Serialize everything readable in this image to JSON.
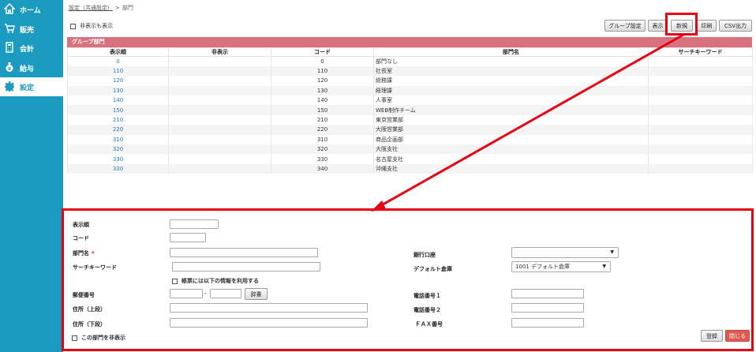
{
  "sidebar": {
    "items": [
      {
        "label": "ホーム",
        "icon": "home-icon"
      },
      {
        "label": "販売",
        "icon": "cart-icon"
      },
      {
        "label": "会計",
        "icon": "calculator-icon"
      },
      {
        "label": "給与",
        "icon": "money-bag-icon"
      },
      {
        "label": "設定",
        "icon": "gear-icon"
      }
    ],
    "active_color": "#1c9bc0"
  },
  "breadcrumb": {
    "parent": "設定（共通設定）",
    "separator": ">",
    "current": "部門"
  },
  "show_hidden_label": "非表示も表示",
  "toolbar": {
    "group_settings": "グループ設定",
    "display": "表示",
    "new": "新規",
    "print": "印刷",
    "csv": "CSV出力"
  },
  "group_header": "グループ部門",
  "columns": {
    "order": "表示順",
    "hidden": "非表示",
    "code": "コード",
    "name": "部門名",
    "keyword": "サーチキーワード"
  },
  "rows": [
    {
      "order": "0",
      "code": "0",
      "name": "部門なし"
    },
    {
      "order": "110",
      "code": "110",
      "name": "社長室"
    },
    {
      "order": "120",
      "code": "120",
      "name": "総務課"
    },
    {
      "order": "130",
      "code": "130",
      "name": "経理課"
    },
    {
      "order": "140",
      "code": "140",
      "name": "人事室"
    },
    {
      "order": "150",
      "code": "150",
      "name": "WEB制作チーム"
    },
    {
      "order": "210",
      "code": "210",
      "name": "東京営業部"
    },
    {
      "order": "220",
      "code": "220",
      "name": "大阪営業部"
    },
    {
      "order": "310",
      "code": "310",
      "name": "商品企画部"
    },
    {
      "order": "320",
      "code": "320",
      "name": "大阪支社"
    },
    {
      "order": "330",
      "code": "330",
      "name": "名古屋支社"
    },
    {
      "order": "330",
      "code": "340",
      "name": "沖縄支社"
    }
  ],
  "form": {
    "order_label": "表示順",
    "code_label": "コード",
    "name_label": "部門名",
    "required_mark": "*",
    "keyword_label": "サーチキーワード",
    "use_info_label": "帳票には以下の情報を利用する",
    "zip_label": "郵便番号",
    "zip_sep": "-",
    "dict_button": "辞書",
    "addr1_label": "住所（上段）",
    "addr2_label": "住所（下段）",
    "bank_label": "銀行口座",
    "warehouse_label": "デフォルト倉庫",
    "warehouse_value": "1001 デフォルト倉庫",
    "phone1_label": "電話番号１",
    "phone2_label": "電話番号２",
    "fax_label": "ＦＡＸ番号",
    "hide_dept_label": "この部門を非表示",
    "register_button": "登録",
    "close_button": "閉じる"
  },
  "colors": {
    "sidebar": "#1c9bc0",
    "group_header": "#d9707d",
    "highlight": "#e60012",
    "link": "#1c7fb8"
  }
}
